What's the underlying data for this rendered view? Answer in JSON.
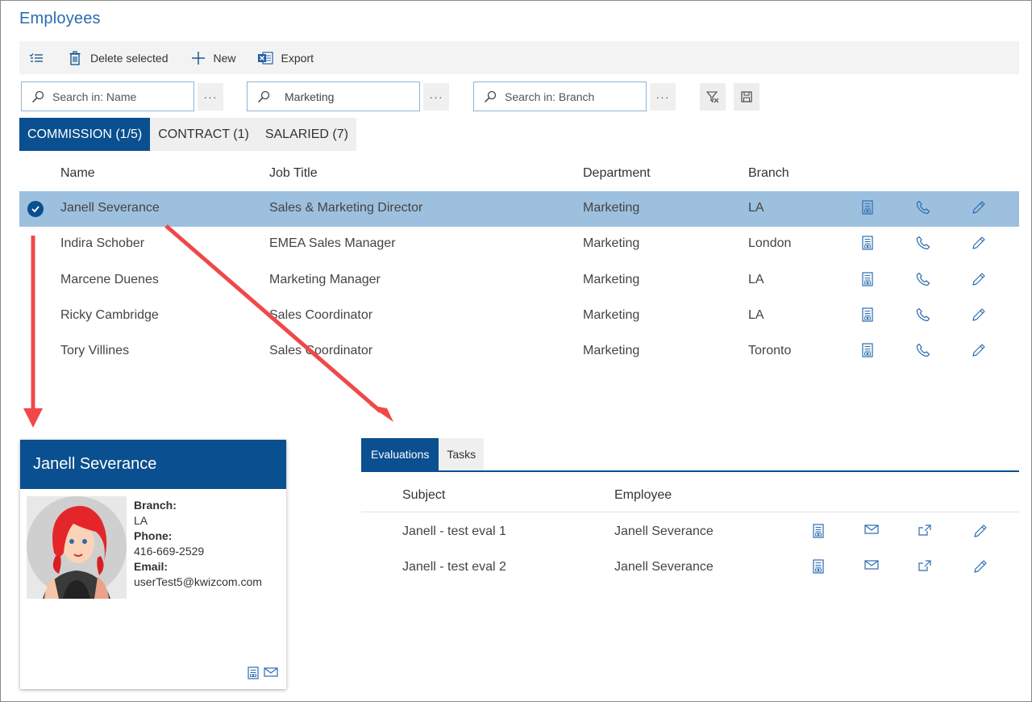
{
  "page": {
    "title": "Employees"
  },
  "toolbar": {
    "delete_label": "Delete selected",
    "new_label": "New",
    "export_label": "Export"
  },
  "search": {
    "name_placeholder": "Search in: Name",
    "department_value": "Marketing",
    "branch_placeholder": "Search in: Branch",
    "more_label": "···"
  },
  "tabs": [
    {
      "label": "COMMISSION (1/5)",
      "active": true
    },
    {
      "label": "CONTRACT (1)",
      "active": false
    },
    {
      "label": "SALARIED (7)",
      "active": false
    }
  ],
  "grid": {
    "columns": {
      "name": "Name",
      "job_title": "Job Title",
      "department": "Department",
      "branch": "Branch"
    },
    "rows": [
      {
        "name": "Janell Severance",
        "job_title": "Sales & Marketing Director",
        "department": "Marketing",
        "branch": "LA",
        "selected": true
      },
      {
        "name": "Indira Schober",
        "job_title": "EMEA Sales Manager",
        "department": "Marketing",
        "branch": "London",
        "selected": false
      },
      {
        "name": "Marcene Duenes",
        "job_title": "Marketing Manager",
        "department": "Marketing",
        "branch": "LA",
        "selected": false
      },
      {
        "name": "Ricky Cambridge",
        "job_title": "Sales Coordinator",
        "department": "Marketing",
        "branch": "LA",
        "selected": false
      },
      {
        "name": "Tory Villines",
        "job_title": "Sales Coordinator",
        "department": "Marketing",
        "branch": "Toronto",
        "selected": false
      }
    ],
    "row_icons": [
      "form-icon",
      "phone-icon",
      "edit-icon"
    ]
  },
  "card": {
    "name": "Janell Severance",
    "branch_label": "Branch:",
    "branch": "LA",
    "phone_label": "Phone:",
    "phone": "416-669-2529",
    "email_label": "Email:",
    "email": "userTest5@kwizcom.com",
    "footer_icons": [
      "form-icon",
      "mail-icon"
    ]
  },
  "details": {
    "tabs": [
      {
        "label": "Evaluations",
        "active": true
      },
      {
        "label": "Tasks",
        "active": false
      }
    ],
    "columns": {
      "subject": "Subject",
      "employee": "Employee"
    },
    "rows": [
      {
        "subject": "Janell - test eval 1",
        "employee": "Janell Severance"
      },
      {
        "subject": "Janell - test eval 2",
        "employee": "Janell Severance"
      }
    ],
    "row_icons": [
      "form-icon",
      "mail-icon",
      "open-external-icon",
      "edit-icon"
    ]
  },
  "colors": {
    "accent": "#0a4f8f",
    "title_blue": "#2b6cb0",
    "selected_row": "#9dc0de",
    "annotation_arrow": "#f04848"
  }
}
